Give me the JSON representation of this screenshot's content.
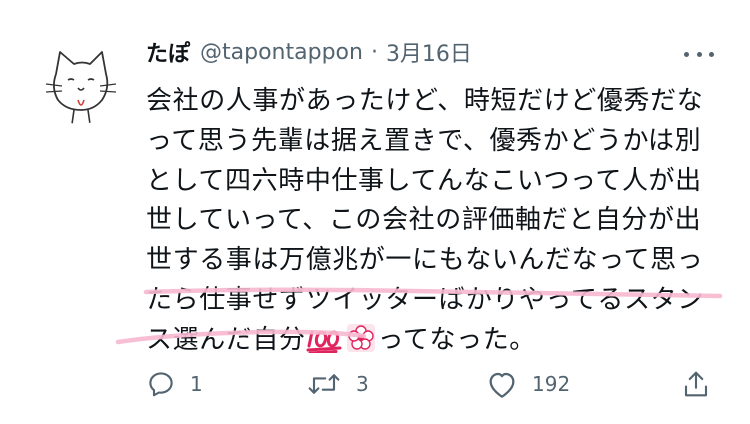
{
  "tweet": {
    "display_name": "たぽ",
    "handle": "@tapontappon",
    "separator": "·",
    "date": "3月16日",
    "text_lines": [
      "会社の人事があったけど、時短だけど優秀だな",
      "って思う先輩は据え置きで、優秀かどうかは別",
      "として四六時中仕事してんなこいつって人が出",
      "世していって、この会社の評価軸だと自分が出",
      "世する事は万億兆が一にもないんだなって思っ",
      "たら仕事せずツイッターばかりやってるスタン"
    ],
    "last_line_prefix": "ス選んだ自分",
    "last_line_suffix": "ってなった。",
    "emojis": [
      "hundred-points-icon",
      "white-flower-icon"
    ],
    "highlight_color": "#f7b8cf"
  },
  "actions": {
    "reply_count": "1",
    "retweet_count": "3",
    "like_count": "192",
    "share_count": ""
  },
  "colors": {
    "text": "#0f1419",
    "secondary": "#536471",
    "emoji_red": "#e0245e"
  }
}
